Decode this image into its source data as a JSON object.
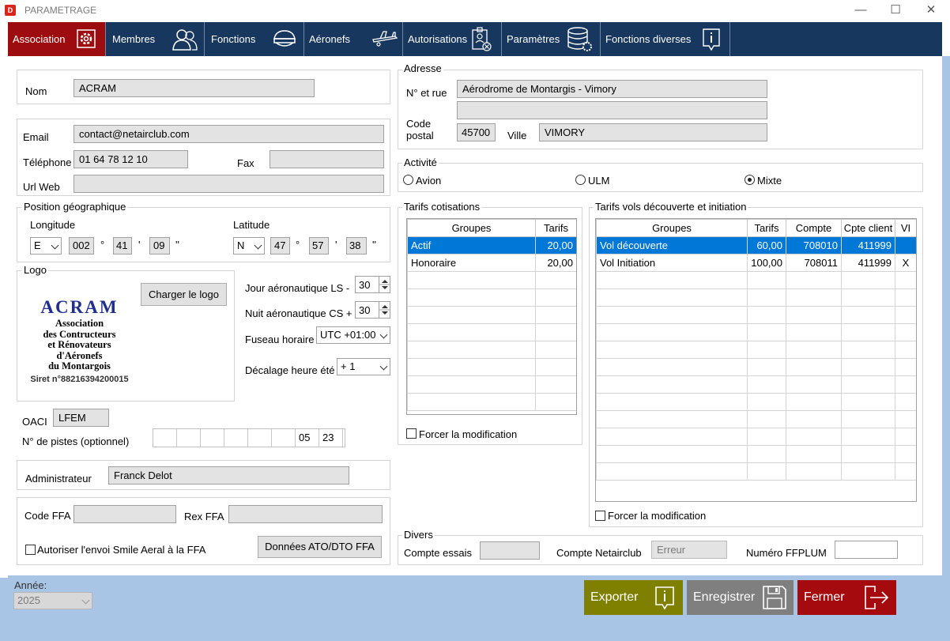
{
  "window": {
    "title": "PARAMETRAGE",
    "app_icon": "D",
    "minimize": "—",
    "maximize": "☐",
    "close": "✕"
  },
  "tabs": [
    {
      "label": "Association",
      "icon": "gear-icon"
    },
    {
      "label": "Membres",
      "icon": "users-icon"
    },
    {
      "label": "Fonctions",
      "icon": "pilot-cap-icon"
    },
    {
      "label": "Aéronefs",
      "icon": "plane-icon"
    },
    {
      "label": "Autorisations",
      "icon": "badge-icon"
    },
    {
      "label": "Paramètres",
      "icon": "database-gear-icon"
    },
    {
      "label": "Fonctions diverses",
      "icon": "info-icon"
    }
  ],
  "identity": {
    "nom_label": "Nom",
    "nom_value": "ACRAM"
  },
  "contact": {
    "email_label": "Email",
    "email_value": "contact@netairclub.com",
    "tel_label": "Téléphone",
    "tel_value": "01 64 78 12 10",
    "fax_label": "Fax",
    "fax_value": "",
    "url_label": "Url Web",
    "url_value": ""
  },
  "position": {
    "title": "Position géographique",
    "longitude_label": "Longitude",
    "lon_dir": "E",
    "lon_deg": "002",
    "lon_min": "41",
    "lon_sec": "09",
    "latitude_label": "Latitude",
    "lat_dir": "N",
    "lat_deg": "47",
    "lat_min": "57",
    "lat_sec": "38",
    "deg_sym": "°",
    "min_sym": "'",
    "sec_sym": "''"
  },
  "logo": {
    "title": "Logo",
    "button": "Charger le logo",
    "line1": "ACRAM",
    "line2": "Association",
    "line3": "des Contructeurs",
    "line4": "et Rénovateurs",
    "line5": "d'Aéronefs",
    "line6": "du Montargois",
    "siret": "Siret n°88216394200015"
  },
  "times": {
    "jour_label": "Jour aéronautique LS -",
    "jour_value": "30",
    "nuit_label": "Nuit aéronautique CS +",
    "nuit_value": "30",
    "fuseau_label": "Fuseau horaire",
    "fuseau_value": "UTC +01:00",
    "decalage_label": "Décalage heure été",
    "decalage_value": "+ 1"
  },
  "oaci": {
    "label": "OACI",
    "value": "LFEM",
    "pistes_label": "N° de pistes (optionnel)",
    "pistes": [
      "",
      "",
      "",
      "",
      "",
      "",
      "05",
      "23"
    ]
  },
  "admin": {
    "label": "Administrateur",
    "value": "Franck Delot"
  },
  "ffa": {
    "code_label": "Code FFA",
    "code_value": "",
    "rex_label": "Rex FFA",
    "rex_value": "",
    "smile_label": "Autoriser l'envoi Smile Aeral à la FFA",
    "ato_button": "Données ATO/DTO FFA"
  },
  "adresse": {
    "title": "Adresse",
    "rue_label": "N° et rue",
    "rue_value": "Aérodrome de Montargis - Vimory",
    "rue2_value": "",
    "cp_label1": "Code",
    "cp_label2": "postal",
    "cp_value": "45700",
    "ville_label": "Ville",
    "ville_value": "VIMORY"
  },
  "activite": {
    "title": "Activité",
    "options": [
      "Avion",
      "ULM",
      "Mixte"
    ],
    "selected": "Mixte"
  },
  "cotisations": {
    "title": "Tarifs cotisations",
    "headers": [
      "Groupes",
      "Tarifs"
    ],
    "rows": [
      [
        "Actif",
        "20,00"
      ],
      [
        "Honoraire",
        "20,00"
      ]
    ],
    "force_label": "Forcer la modification"
  },
  "decouverte": {
    "title": "Tarifs vols découverte et initiation",
    "headers": [
      "Groupes",
      "Tarifs",
      "Compte",
      "Cpte client",
      "VI"
    ],
    "rows": [
      [
        "Vol découverte",
        "60,00",
        "708010",
        "411999",
        ""
      ],
      [
        "Vol Initiation",
        "100,00",
        "708011",
        "411999",
        "X"
      ]
    ],
    "force_label": "Forcer la modification"
  },
  "divers": {
    "title": "Divers",
    "essais_label": "Compte essais",
    "essais_value": "",
    "netair_label": "Compte Netairclub",
    "netair_value": "Erreur",
    "ffplum_label": "Numéro FFPLUM",
    "ffplum_value": ""
  },
  "footer": {
    "annee_label": "Année:",
    "annee_value": "2025",
    "export": "Exporter",
    "save": "Enregistrer",
    "close": "Fermer"
  },
  "colors": {
    "tab_bg": "#17375e",
    "tab_active": "#9d0d10",
    "export_bg": "#7f7f00",
    "save_bg": "#7f7f7f",
    "close_bg": "#a50b0e",
    "selection": "#0078d7"
  }
}
